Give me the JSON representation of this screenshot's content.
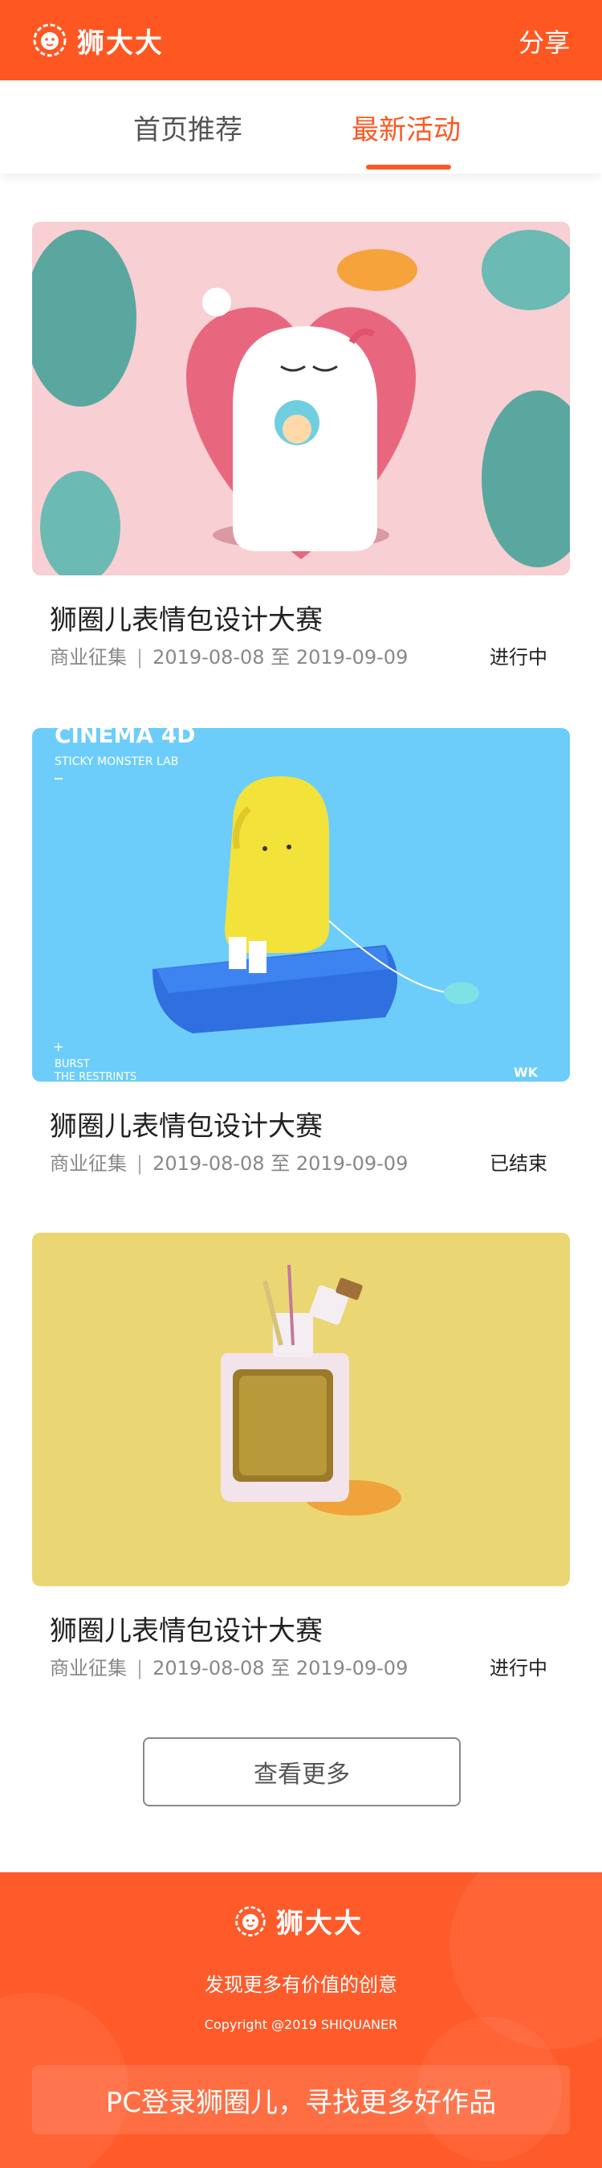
{
  "header": {
    "brand": "狮大大",
    "share_label": "分享"
  },
  "tabs": [
    {
      "label": "首页推荐",
      "active": false
    },
    {
      "label": "最新活动",
      "active": true
    }
  ],
  "activities": [
    {
      "title": "狮圈儿表情包设计大赛",
      "category": "商业征集",
      "separator": "|",
      "start": "2019-08-08",
      "to": "至",
      "end": "2019-09-09",
      "status": "进行中"
    },
    {
      "title": "狮圈儿表情包设计大赛",
      "category": "商业征集",
      "separator": "|",
      "start": "2019-08-08",
      "to": "至",
      "end": "2019-09-09",
      "status": "已结束",
      "image_text": {
        "heading": "CINEMA 4D",
        "sub": "STICKY MONSTER LAB",
        "plus": "+",
        "burst": "BURST",
        "restrints": "THE RESTRINTS",
        "corner": "WK"
      }
    },
    {
      "title": "狮圈儿表情包设计大赛",
      "category": "商业征集",
      "separator": "|",
      "start": "2019-08-08",
      "to": "至",
      "end": "2019-09-09",
      "status": "进行中"
    }
  ],
  "load_more": "查看更多",
  "footer": {
    "brand": "狮大大",
    "slogan": "发现更多有价值的创意",
    "copyright": "Copyright @2019 SHIQUANER",
    "cta": "PC登录狮圈儿，寻找更多好作品"
  },
  "colors": {
    "accent": "#ff5722",
    "footer_bg": "#ff5a2a"
  }
}
